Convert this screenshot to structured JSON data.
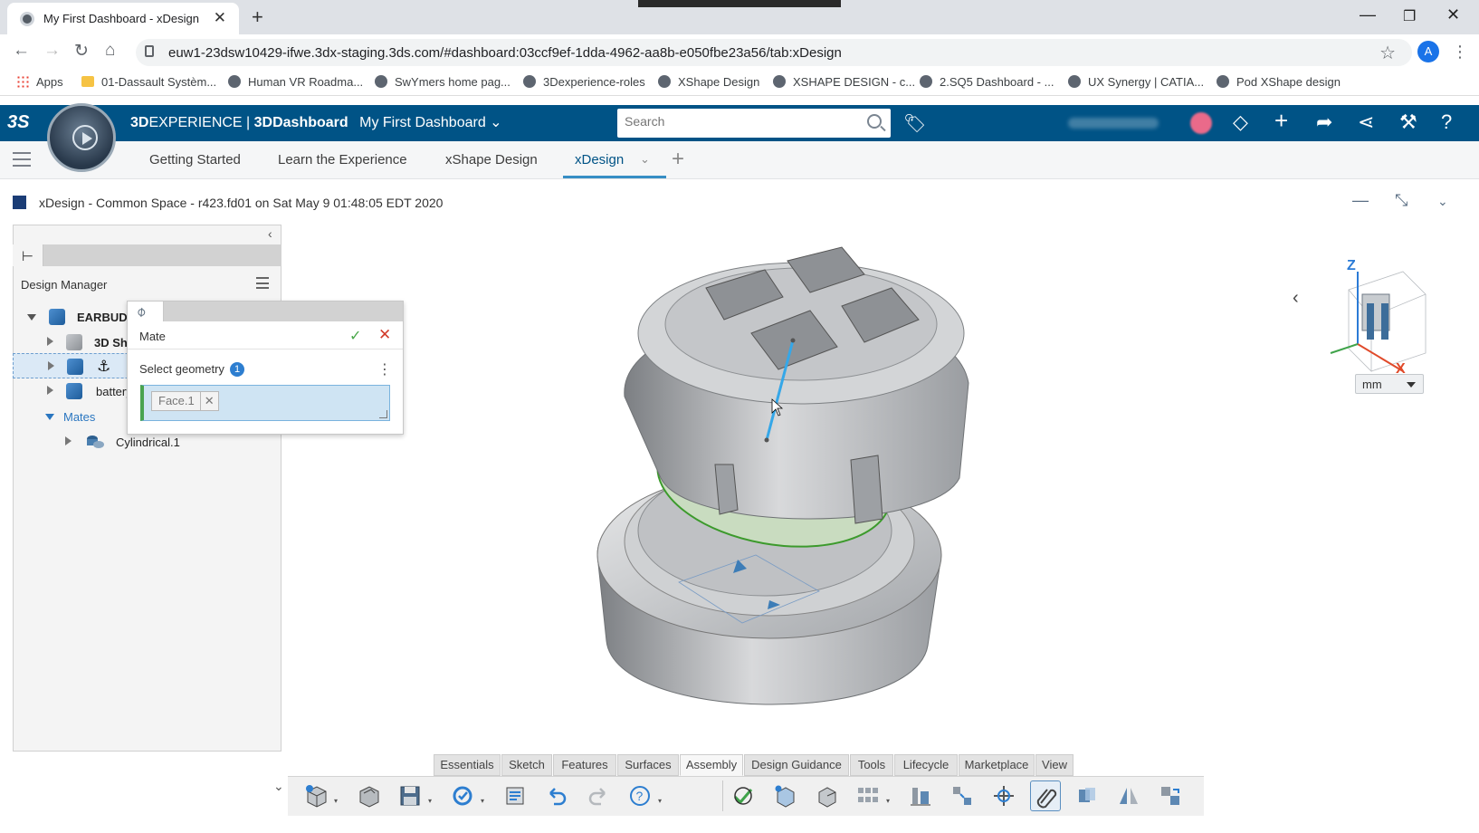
{
  "browser": {
    "tab_title": "My First Dashboard - xDesign",
    "url": "euw1-23dsw10429-ifwe.3dx-staging.3ds.com/#dashboard:03ccf9ef-1dda-4962-aa8b-e050fbe23a56/tab:xDesign",
    "profile_initial": "A",
    "bookmarks": [
      {
        "label": "Apps"
      },
      {
        "label": "01-Dassault Systèm..."
      },
      {
        "label": "Human VR Roadma..."
      },
      {
        "label": "SwYmers home pag..."
      },
      {
        "label": "3Dexperience-roles"
      },
      {
        "label": "XShape Design"
      },
      {
        "label": "XSHAPE DESIGN - c..."
      },
      {
        "label": "2.SQ5 Dashboard - ..."
      },
      {
        "label": "UX Synergy | CATIA..."
      },
      {
        "label": "Pod XShape design"
      }
    ]
  },
  "topbar": {
    "brand_3d": "3D",
    "brand_experience": "EXPERIENCE",
    "brand_sep": " | ",
    "brand_app": "3DDashboard",
    "dashboard_name": "My First Dashboard",
    "search_placeholder": "Search",
    "accent_color": "#005386"
  },
  "dashboard_tabs": [
    {
      "label": "Getting Started"
    },
    {
      "label": "Learn the Experience"
    },
    {
      "label": "xShape Design"
    },
    {
      "label": "xDesign",
      "active": true
    }
  ],
  "app_header": {
    "title": "xDesign - Common Space - r423.fd01 on Sat May 9 01:48:05 EDT 2020"
  },
  "design_manager": {
    "title": "Design Manager",
    "tree": [
      {
        "label": "EARBUD...",
        "bold": true
      },
      {
        "label": "3D Sh...",
        "bold": true
      },
      {
        "label": ""
      },
      {
        "label": "battery"
      },
      {
        "label": "Mates",
        "link": true
      },
      {
        "label": "Cylindrical.1"
      }
    ]
  },
  "mate_dialog": {
    "title": "Mate",
    "select_label": "Select geometry",
    "select_count": "1",
    "chip": "Face.1"
  },
  "viewport": {
    "unit": "mm",
    "axis_z": "Z",
    "axis_x": "X"
  },
  "command_tabs": [
    {
      "label": "Essentials"
    },
    {
      "label": "Sketch"
    },
    {
      "label": "Features"
    },
    {
      "label": "Surfaces"
    },
    {
      "label": "Assembly",
      "active": true
    },
    {
      "label": "Design Guidance"
    },
    {
      "label": "Tools"
    },
    {
      "label": "Lifecycle"
    },
    {
      "label": "Marketplace"
    },
    {
      "label": "View"
    }
  ],
  "toolbar_icons": [
    "new-part-icon",
    "open-icon",
    "save-icon",
    "regenerate-icon",
    "properties-icon",
    "undo-icon",
    "redo-icon",
    "help-icon",
    "fix-icon",
    "insert-component-icon",
    "new-component-icon",
    "pattern-icon",
    "align-icon",
    "explode-icon",
    "move-icon",
    "mate-icon",
    "interference-icon",
    "mirror-icon",
    "replace-icon"
  ]
}
